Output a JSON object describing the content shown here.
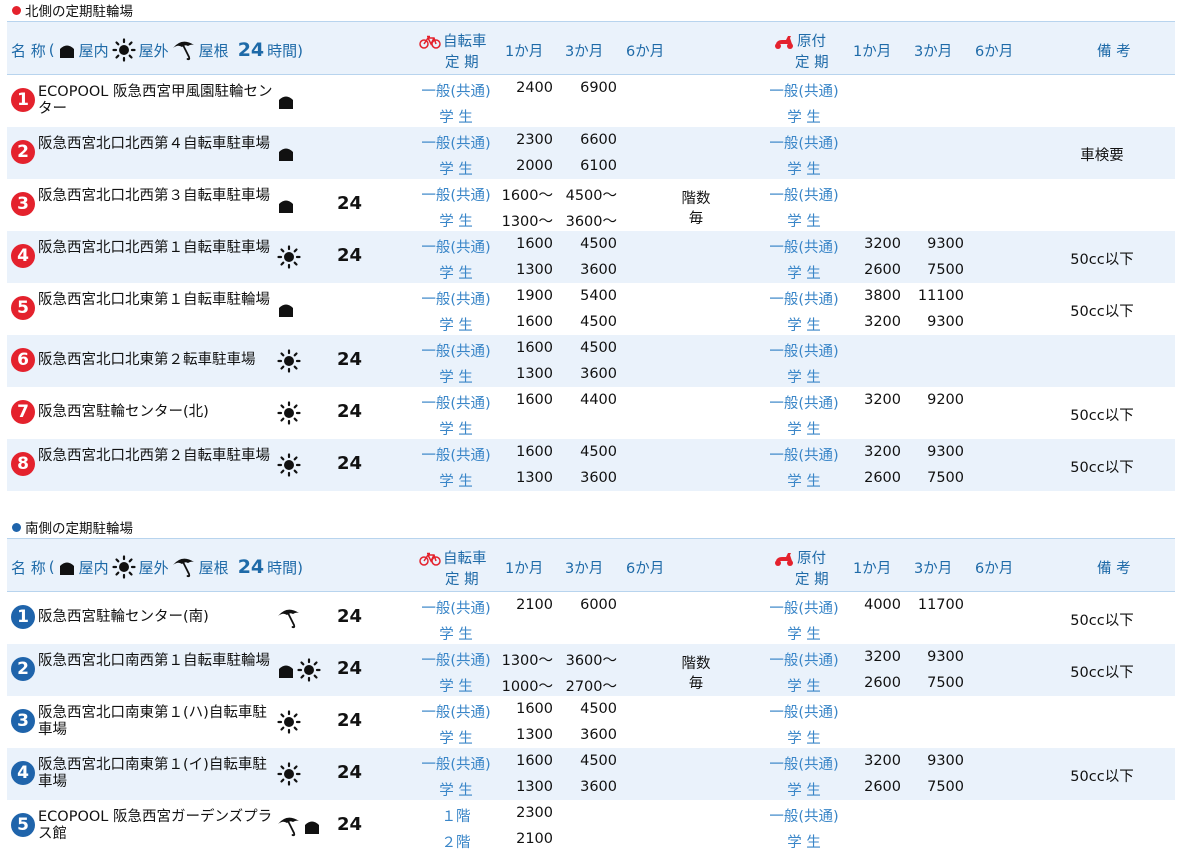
{
  "north": {
    "title": "北側の定期駐輪場",
    "dot_color": "#e4222d",
    "header": {
      "name": "名 称",
      "paren_open": "(",
      "indoor": "屋内",
      "outdoor": "屋外",
      "roof": "屋根",
      "h24": "24",
      "hours": "時間)",
      "bike_label_1": "自転車",
      "bike_label_2": "定 期",
      "m1": "1か月",
      "m3": "3か月",
      "m6": "6か月",
      "moped_label_1": "原付",
      "moped_label_2": "定 期",
      "mm1": "1か月",
      "mm3": "3か月",
      "mm6": "6か月",
      "note": "備 考"
    },
    "rows": [
      {
        "num": "1",
        "name": "ECOPOOL 阪急西宮甲風園駐輪センター",
        "icons": [
          "indoor"
        ],
        "h24": "",
        "b": [
          [
            "一般(共通)",
            "2400",
            "6900"
          ],
          [
            "学 生",
            "",
            ""
          ]
        ],
        "b6": "",
        "m": [
          [
            "一般(共通)",
            "",
            ""
          ],
          [
            "学 生",
            "",
            ""
          ]
        ],
        "note": ""
      },
      {
        "num": "2",
        "name": "阪急西宮北口北西第４自転車駐車場",
        "icons": [
          "indoor"
        ],
        "h24": "",
        "b": [
          [
            "一般(共通)",
            "2300",
            "6600"
          ],
          [
            "学 生",
            "2000",
            "6100"
          ]
        ],
        "b6": "",
        "m": [
          [
            "一般(共通)",
            "",
            ""
          ],
          [
            "学 生",
            "",
            ""
          ]
        ],
        "note": "車検要"
      },
      {
        "num": "3",
        "name": "阪急西宮北口北西第３自転車駐車場",
        "icons": [
          "indoor"
        ],
        "h24": "24",
        "b": [
          [
            "一般(共通)",
            "1600～",
            "4500～"
          ],
          [
            "学 生",
            "1300～",
            "3600～"
          ]
        ],
        "b6": "階数\n毎",
        "m": [
          [
            "一般(共通)",
            "",
            ""
          ],
          [
            "学 生",
            "",
            ""
          ]
        ],
        "note": ""
      },
      {
        "num": "4",
        "name": "阪急西宮北口北西第１自転車駐車場",
        "icons": [
          "outdoor"
        ],
        "h24": "24",
        "b": [
          [
            "一般(共通)",
            "1600",
            "4500"
          ],
          [
            "学 生",
            "1300",
            "3600"
          ]
        ],
        "b6": "",
        "m": [
          [
            "一般(共通)",
            "3200",
            "9300"
          ],
          [
            "学 生",
            "2600",
            "7500"
          ]
        ],
        "note": "50cc以下"
      },
      {
        "num": "5",
        "name": "阪急西宮北口北東第１自転車駐輪場",
        "icons": [
          "indoor"
        ],
        "h24": "",
        "b": [
          [
            "一般(共通)",
            "1900",
            "5400"
          ],
          [
            "学 生",
            "1600",
            "4500"
          ]
        ],
        "b6": "",
        "m": [
          [
            "一般(共通)",
            "3800",
            "11100"
          ],
          [
            "学 生",
            "3200",
            "9300"
          ]
        ],
        "note": "50cc以下"
      },
      {
        "num": "6",
        "name": "阪急西宮北口北東第２転車駐車場",
        "icons": [
          "outdoor"
        ],
        "h24": "24",
        "b": [
          [
            "一般(共通)",
            "1600",
            "4500"
          ],
          [
            "学 生",
            "1300",
            "3600"
          ]
        ],
        "b6": "",
        "m": [
          [
            "一般(共通)",
            "",
            ""
          ],
          [
            "学 生",
            "",
            ""
          ]
        ],
        "note": ""
      },
      {
        "num": "7",
        "name": "阪急西宮駐輪センター(北)",
        "icons": [
          "outdoor"
        ],
        "h24": "24",
        "b": [
          [
            "一般(共通)",
            "1600",
            "4400"
          ],
          [
            "学 生",
            "",
            ""
          ]
        ],
        "b6": "",
        "m": [
          [
            "一般(共通)",
            "3200",
            "9200"
          ],
          [
            "学 生",
            "",
            ""
          ]
        ],
        "note": "50cc以下"
      },
      {
        "num": "8",
        "name": "阪急西宮北口北西第２自転車駐車場",
        "icons": [
          "outdoor"
        ],
        "h24": "24",
        "b": [
          [
            "一般(共通)",
            "1600",
            "4500"
          ],
          [
            "学 生",
            "1300",
            "3600"
          ]
        ],
        "b6": "",
        "m": [
          [
            "一般(共通)",
            "3200",
            "9300"
          ],
          [
            "学 生",
            "2600",
            "7500"
          ]
        ],
        "note": "50cc以下"
      }
    ]
  },
  "south": {
    "title": "南側の定期駐輪場",
    "dot_color": "#1f64ab",
    "header": {
      "name": "名 称",
      "paren_open": "(",
      "indoor": "屋内",
      "outdoor": "屋外",
      "roof": "屋根",
      "h24": "24",
      "hours": "時間)",
      "bike_label_1": "自転車",
      "bike_label_2": "定 期",
      "m1": "1か月",
      "m3": "3か月",
      "m6": "6か月",
      "moped_label_1": "原付",
      "moped_label_2": "定 期",
      "mm1": "1か月",
      "mm3": "3か月",
      "mm6": "6か月",
      "note": "備 考"
    },
    "rows": [
      {
        "num": "1",
        "name": "阪急西宮駐輪センター(南)",
        "icons": [
          "roof"
        ],
        "h24": "24",
        "b": [
          [
            "一般(共通)",
            "2100",
            "6000"
          ],
          [
            "学 生",
            "",
            ""
          ]
        ],
        "b6": "",
        "m": [
          [
            "一般(共通)",
            "4000",
            "11700"
          ],
          [
            "学 生",
            "",
            ""
          ]
        ],
        "note": "50cc以下"
      },
      {
        "num": "2",
        "name": "阪急西宮北口南西第１自転車駐輪場",
        "icons": [
          "indoor",
          "outdoor"
        ],
        "h24": "24",
        "b": [
          [
            "一般(共通)",
            "1300～",
            "3600～"
          ],
          [
            "学 生",
            "1000～",
            "2700～"
          ]
        ],
        "b6": "階数\n毎",
        "m": [
          [
            "一般(共通)",
            "3200",
            "9300"
          ],
          [
            "学 生",
            "2600",
            "7500"
          ]
        ],
        "note": "50cc以下"
      },
      {
        "num": "3",
        "name": "阪急西宮北口南東第１(ハ)自転車駐車場",
        "icons": [
          "outdoor"
        ],
        "h24": "24",
        "b": [
          [
            "一般(共通)",
            "1600",
            "4500"
          ],
          [
            "学 生",
            "1300",
            "3600"
          ]
        ],
        "b6": "",
        "m": [
          [
            "一般(共通)",
            "",
            ""
          ],
          [
            "学 生",
            "",
            ""
          ]
        ],
        "note": ""
      },
      {
        "num": "4",
        "name": "阪急西宮北口南東第１(イ)自転車駐車場",
        "icons": [
          "outdoor"
        ],
        "h24": "24",
        "b": [
          [
            "一般(共通)",
            "1600",
            "4500"
          ],
          [
            "学 生",
            "1300",
            "3600"
          ]
        ],
        "b6": "",
        "m": [
          [
            "一般(共通)",
            "3200",
            "9300"
          ],
          [
            "学 生",
            "2600",
            "7500"
          ]
        ],
        "note": "50cc以下"
      },
      {
        "num": "5",
        "name": "ECOPOOL 阪急西宮ガーデンズプラス館",
        "icons": [
          "roof",
          "indoor"
        ],
        "h24": "24",
        "b": [
          [
            "１階",
            "2300",
            ""
          ],
          [
            "２階",
            "2100",
            ""
          ]
        ],
        "b6": "",
        "m": [
          [
            "一般(共通)",
            "",
            ""
          ],
          [
            "学 生",
            "",
            ""
          ]
        ],
        "note": ""
      }
    ]
  }
}
